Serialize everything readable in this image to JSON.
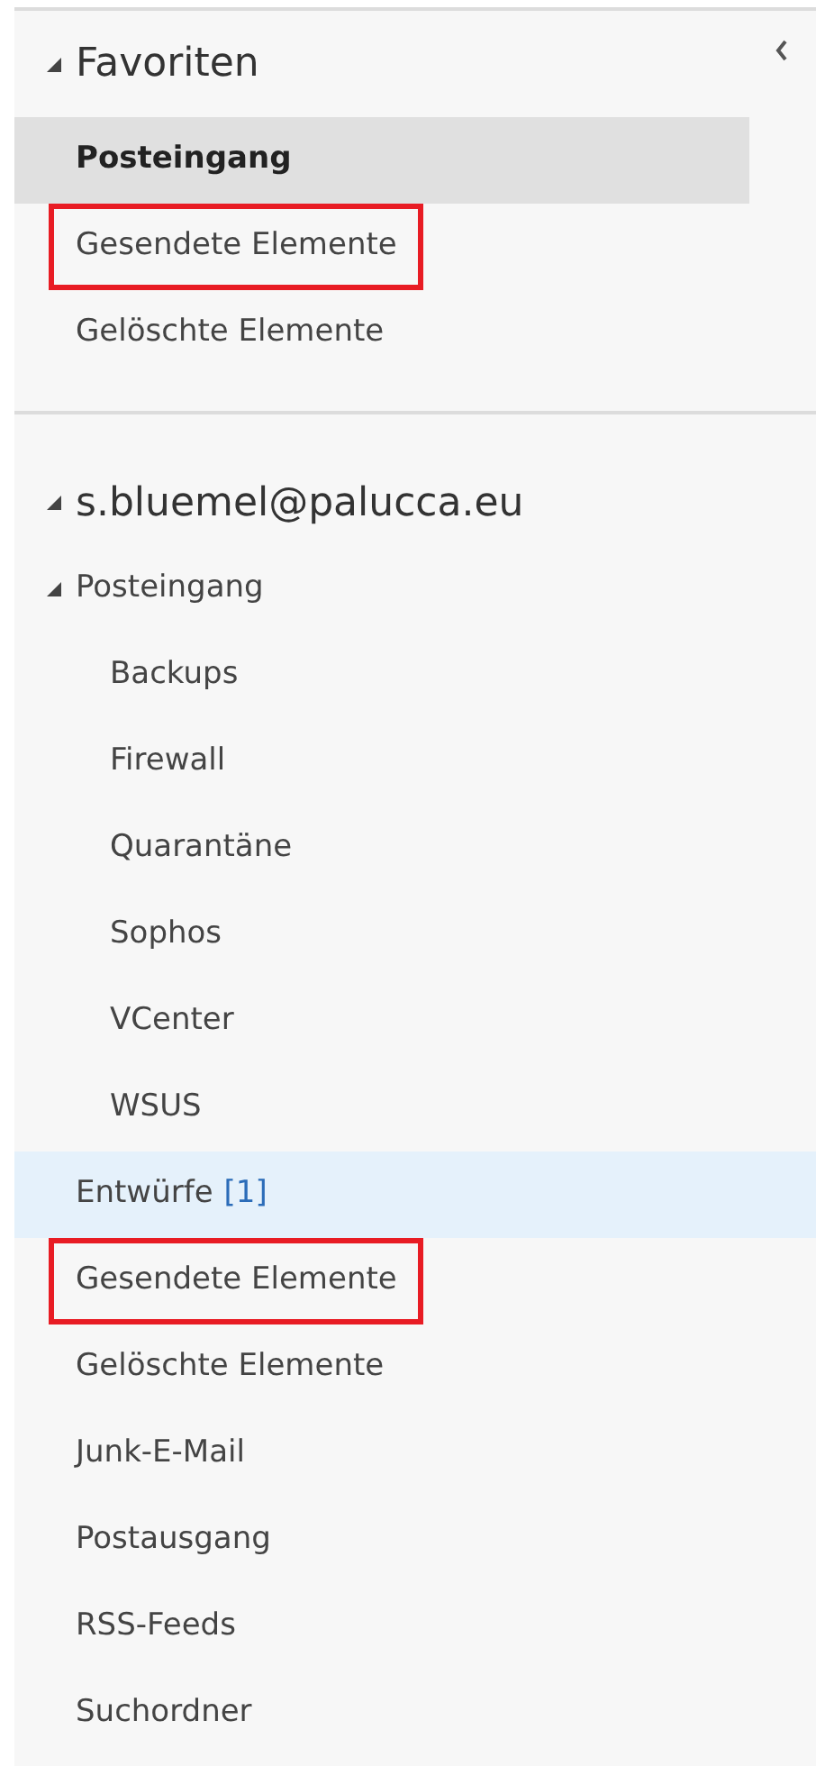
{
  "favorites": {
    "title": "Favoriten",
    "expanded": true,
    "items": [
      {
        "label": "Posteingang",
        "selected": true,
        "highlighted": false
      },
      {
        "label": "Gesendete Elemente",
        "selected": false,
        "highlighted": true
      },
      {
        "label": "Gelöschte Elemente",
        "selected": false,
        "highlighted": false
      }
    ]
  },
  "account": {
    "title": "s.bluemel@palucca.eu",
    "expanded": true,
    "folders": [
      {
        "label": "Posteingang",
        "expanded": true,
        "hovered": false,
        "highlighted": false,
        "children": [
          {
            "label": "Backups",
            "hovered": false,
            "highlighted": false
          },
          {
            "label": "Firewall",
            "hovered": false,
            "highlighted": false
          },
          {
            "label": "Quarantäne",
            "hovered": false,
            "highlighted": false
          },
          {
            "label": "Sophos",
            "hovered": false,
            "highlighted": false
          },
          {
            "label": "VCenter",
            "hovered": false,
            "highlighted": false
          },
          {
            "label": "WSUS",
            "hovered": false,
            "highlighted": false
          }
        ]
      },
      {
        "label": "Entwürfe",
        "count": "[1]",
        "hovered": true,
        "highlighted": false
      },
      {
        "label": "Gesendete Elemente",
        "hovered": false,
        "highlighted": true
      },
      {
        "label": "Gelöschte Elemente",
        "hovered": false,
        "highlighted": false
      },
      {
        "label": "Junk-E-Mail",
        "hovered": false,
        "highlighted": false
      },
      {
        "label": "Postausgang",
        "hovered": false,
        "highlighted": false
      },
      {
        "label": "RSS-Feeds",
        "hovered": false,
        "highlighted": false
      },
      {
        "label": "Suchordner",
        "hovered": false,
        "highlighted": false
      }
    ]
  }
}
